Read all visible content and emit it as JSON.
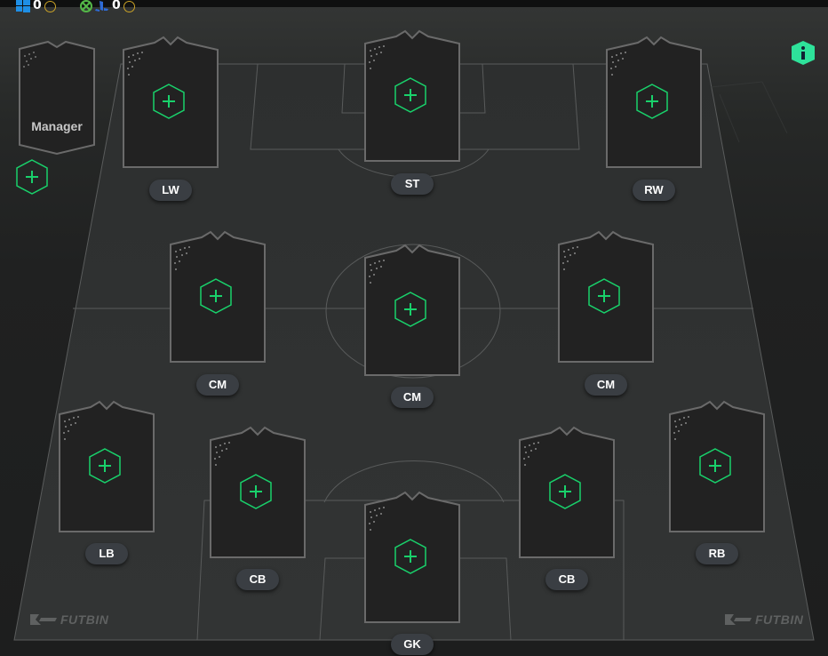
{
  "currency": {
    "pc": {
      "icon": "windows-icon",
      "amount": "0"
    },
    "console": {
      "icons": [
        "xbox-icon",
        "playstation-icon"
      ],
      "amount": "0"
    }
  },
  "manager": {
    "label": "Manager"
  },
  "positions": {
    "lw": "LW",
    "st": "ST",
    "rw": "RW",
    "cm_left": "CM",
    "cm_center": "CM",
    "cm_right": "CM",
    "lb": "LB",
    "cb_left": "CB",
    "gk": "GK",
    "cb_right": "CB",
    "rb": "RB"
  },
  "brand": {
    "name": "FUTBIN"
  },
  "colors": {
    "accent": "#19d16b",
    "info": "#2ee29a",
    "card": "#222222",
    "badge": "#3a3e43"
  }
}
